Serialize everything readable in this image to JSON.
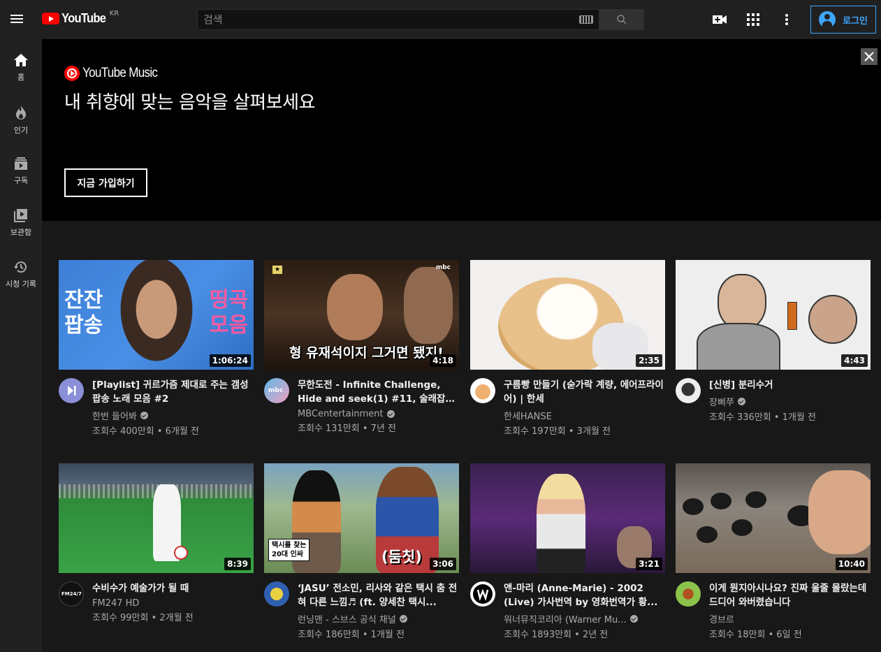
{
  "header": {
    "logo_text": "YouTube",
    "region": "KR",
    "search_placeholder": "검색",
    "signin_label": "로그인"
  },
  "sidebar": {
    "items": [
      {
        "label": "홈",
        "icon": "home-icon"
      },
      {
        "label": "인기",
        "icon": "trending-icon"
      },
      {
        "label": "구독",
        "icon": "subscriptions-icon"
      },
      {
        "label": "보관함",
        "icon": "library-icon"
      },
      {
        "label": "시청 기록",
        "icon": "history-icon"
      }
    ]
  },
  "banner": {
    "logo_text": "YouTube Music",
    "title": "내 취향에 맞는 음악을 살펴보세요",
    "cta": "지금 가입하기"
  },
  "videos": [
    {
      "title": "[Playlist] 귀르가즘 제대로 주는 갬성 팝송 노래 모음 #2",
      "channel": "한번 들어봐",
      "verified": true,
      "stats": "조회수 400만회 • 6개월 전",
      "duration": "1:06:24",
      "thumb_text_left": "잔잔\n팝송",
      "thumb_text_right": "띵곡\n모음"
    },
    {
      "title": "무한도전 - Infinite Challenge, Hide and seek(1) #11, 술래잡기...",
      "channel": "MBCentertainment",
      "verified": true,
      "stats": "조회수 131만회 • 7년 전",
      "duration": "4:18",
      "thumb_caption": "형 유재석이지 그거면 됐지!",
      "thumb_badge": "mbc"
    },
    {
      "title": "구름빵 만들기 (숟가락 계량, 에어프라이어) | 한세",
      "channel": "한세HANSE",
      "verified": false,
      "stats": "조회수 197만회 • 3개월 전",
      "duration": "2:35"
    },
    {
      "title": "[신병] 분리수거",
      "channel": "장삐쭈",
      "verified": true,
      "stats": "조회수 336만회 • 1개월 전",
      "duration": "4:43"
    },
    {
      "title": "수비수가 예술가가 될 때",
      "channel": "FM247 HD",
      "verified": false,
      "stats": "조회수 99만회 • 2개월 전",
      "duration": "8:39",
      "avatar_text": "FM24/7"
    },
    {
      "title": "‘JASU’ 전소민, 리사와 같은 택시 춤 전혀 다른 느낌♬ (ft. 양세찬 택시...",
      "channel": "런닝맨 - 스브스 공식 채널",
      "verified": true,
      "stats": "조회수 186만회 • 1개월 전",
      "duration": "3:06",
      "thumb_tag": "택시를 찾는\n20대 인싸",
      "thumb_caption": "(둠칫)"
    },
    {
      "title": "앤-마리 (Anne-Marie) - 2002 (Live) 가사번역 by 영화번역가 황...",
      "channel": "워너뮤직코리아 (Warner Mu...",
      "verified": true,
      "stats": "조회수 1893만회 • 2년 전",
      "duration": "3:21"
    },
    {
      "title": "이게 뭔지아시나요? 진짜 울줄 몰랐는데 드디어 와버렸습니다",
      "channel": "경브르",
      "verified": false,
      "stats": "조회수 18만회 • 6일 전",
      "duration": "10:40"
    }
  ]
}
